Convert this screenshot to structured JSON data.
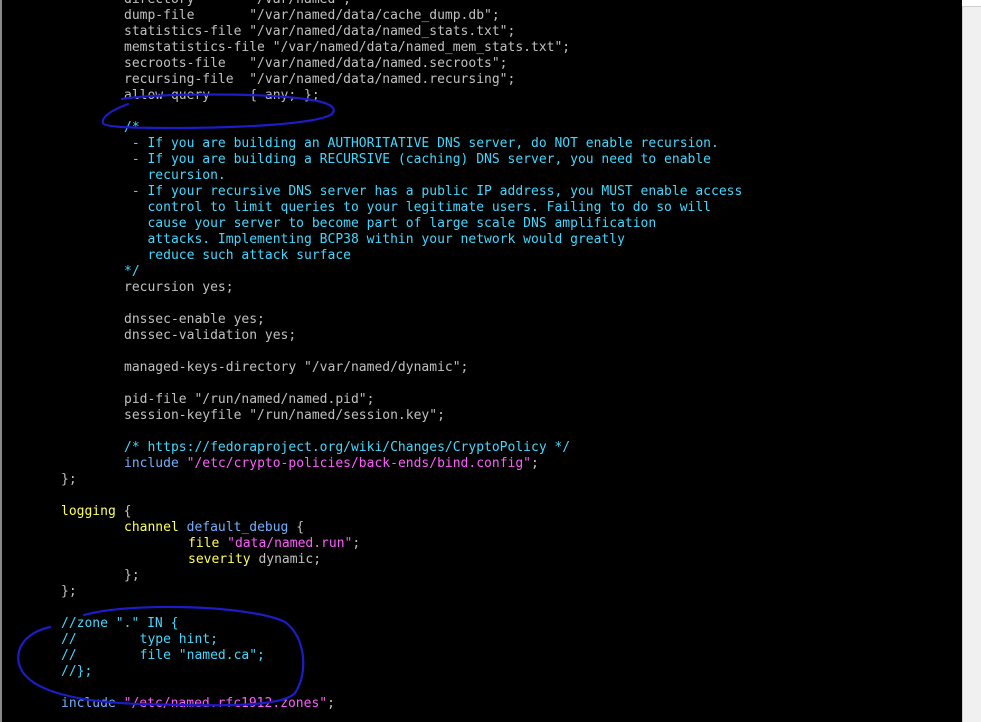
{
  "colors": {
    "background": "#000000",
    "default": "#c0c0c0",
    "comment": "#40d8ff",
    "keyword": "#ffff55",
    "type": "#70b0ff",
    "string": "#ff5cff",
    "annotation": "#1c1cc8"
  },
  "lines": [
    {
      "indent": 2,
      "tokens": [
        {
          "t": "directory       \"/var/named\";",
          "c": "default"
        }
      ]
    },
    {
      "indent": 2,
      "tokens": [
        {
          "t": "dump-file       \"/var/named/data/cache_dump.db\";",
          "c": "default"
        }
      ]
    },
    {
      "indent": 2,
      "tokens": [
        {
          "t": "statistics-file \"/var/named/data/named_stats.txt\";",
          "c": "default"
        }
      ]
    },
    {
      "indent": 2,
      "tokens": [
        {
          "t": "memstatistics-file \"/var/named/data/named_mem_stats.txt\";",
          "c": "default"
        }
      ]
    },
    {
      "indent": 2,
      "tokens": [
        {
          "t": "secroots-file   \"/var/named/data/named.secroots\";",
          "c": "default"
        }
      ]
    },
    {
      "indent": 2,
      "tokens": [
        {
          "t": "recursing-file  \"/var/named/data/named.recursing\";",
          "c": "default"
        }
      ]
    },
    {
      "indent": 2,
      "tokens": [
        {
          "t": "allow-query     { any; };",
          "c": "default"
        }
      ]
    },
    {
      "indent": 0,
      "tokens": []
    },
    {
      "indent": 2,
      "tokens": [
        {
          "t": "/*",
          "c": "comment"
        }
      ]
    },
    {
      "indent": 2,
      "tokens": [
        {
          "t": " - If you are building an AUTHORITATIVE DNS server, do NOT enable recursion.",
          "c": "comment"
        }
      ]
    },
    {
      "indent": 2,
      "tokens": [
        {
          "t": " - If you are building a RECURSIVE (caching) DNS server, you need to enable",
          "c": "comment"
        }
      ]
    },
    {
      "indent": 2,
      "tokens": [
        {
          "t": "   recursion.",
          "c": "comment"
        }
      ]
    },
    {
      "indent": 2,
      "tokens": [
        {
          "t": " - If your recursive DNS server has a public IP address, you MUST enable access",
          "c": "comment"
        }
      ]
    },
    {
      "indent": 2,
      "tokens": [
        {
          "t": "   control to limit queries to your legitimate users. Failing to do so will",
          "c": "comment"
        }
      ]
    },
    {
      "indent": 2,
      "tokens": [
        {
          "t": "   cause your server to become part of large scale DNS amplification",
          "c": "comment"
        }
      ]
    },
    {
      "indent": 2,
      "tokens": [
        {
          "t": "   attacks. Implementing BCP38 within your network would greatly",
          "c": "comment"
        }
      ]
    },
    {
      "indent": 2,
      "tokens": [
        {
          "t": "   reduce such attack surface",
          "c": "comment"
        }
      ]
    },
    {
      "indent": 2,
      "tokens": [
        {
          "t": "*/",
          "c": "comment"
        }
      ]
    },
    {
      "indent": 2,
      "tokens": [
        {
          "t": "recursion yes;",
          "c": "default"
        }
      ]
    },
    {
      "indent": 0,
      "tokens": []
    },
    {
      "indent": 2,
      "tokens": [
        {
          "t": "dnssec-enable yes;",
          "c": "default"
        }
      ]
    },
    {
      "indent": 2,
      "tokens": [
        {
          "t": "dnssec-validation yes;",
          "c": "default"
        }
      ]
    },
    {
      "indent": 0,
      "tokens": []
    },
    {
      "indent": 2,
      "tokens": [
        {
          "t": "managed-keys-directory \"/var/named/dynamic\";",
          "c": "default"
        }
      ]
    },
    {
      "indent": 0,
      "tokens": []
    },
    {
      "indent": 2,
      "tokens": [
        {
          "t": "pid-file \"/run/named/named.pid\";",
          "c": "default"
        }
      ]
    },
    {
      "indent": 2,
      "tokens": [
        {
          "t": "session-keyfile \"/run/named/session.key\";",
          "c": "default"
        }
      ]
    },
    {
      "indent": 0,
      "tokens": []
    },
    {
      "indent": 2,
      "tokens": [
        {
          "t": "/* https://fedoraproject.org/wiki/Changes/CryptoPolicy */",
          "c": "comment"
        }
      ]
    },
    {
      "indent": 2,
      "tokens": [
        {
          "t": "include",
          "c": "type"
        },
        {
          "t": " ",
          "c": "default"
        },
        {
          "t": "\"/etc/crypto-policies/back-ends/bind.config\"",
          "c": "string"
        },
        {
          "t": ";",
          "c": "default"
        }
      ]
    },
    {
      "indent": 1,
      "tokens": [
        {
          "t": "};",
          "c": "default"
        }
      ]
    },
    {
      "indent": 0,
      "tokens": []
    },
    {
      "indent": 1,
      "tokens": [
        {
          "t": "logging",
          "c": "keyword"
        },
        {
          "t": " {",
          "c": "default"
        }
      ]
    },
    {
      "indent": 2,
      "tokens": [
        {
          "t": "channel",
          "c": "keyword"
        },
        {
          "t": " ",
          "c": "default"
        },
        {
          "t": "default_debug",
          "c": "type"
        },
        {
          "t": " {",
          "c": "default"
        }
      ]
    },
    {
      "indent": 3,
      "tokens": [
        {
          "t": "file",
          "c": "keyword"
        },
        {
          "t": " ",
          "c": "default"
        },
        {
          "t": "\"data/named.run\"",
          "c": "string"
        },
        {
          "t": ";",
          "c": "default"
        }
      ]
    },
    {
      "indent": 3,
      "tokens": [
        {
          "t": "severity",
          "c": "keyword"
        },
        {
          "t": " dynamic;",
          "c": "default"
        }
      ]
    },
    {
      "indent": 2,
      "tokens": [
        {
          "t": "};",
          "c": "default"
        }
      ]
    },
    {
      "indent": 1,
      "tokens": [
        {
          "t": "};",
          "c": "default"
        }
      ]
    },
    {
      "indent": 0,
      "tokens": []
    },
    {
      "indent": 1,
      "tokens": [
        {
          "t": "//zone \".\" IN {",
          "c": "comment"
        }
      ]
    },
    {
      "indent": 1,
      "tokens": [
        {
          "t": "//",
          "c": "comment"
        },
        {
          "gap": 1
        },
        {
          "t": "type hint;",
          "c": "comment"
        }
      ]
    },
    {
      "indent": 1,
      "tokens": [
        {
          "t": "//",
          "c": "comment"
        },
        {
          "gap": 1
        },
        {
          "t": "file \"named.ca\";",
          "c": "comment"
        }
      ]
    },
    {
      "indent": 1,
      "tokens": [
        {
          "t": "//};",
          "c": "comment"
        }
      ]
    },
    {
      "indent": 0,
      "tokens": []
    },
    {
      "indent": 1,
      "tokens": [
        {
          "t": "include",
          "c": "type"
        },
        {
          "t": " ",
          "c": "default"
        },
        {
          "t": "\"/etc/named.rfc1912.zones\"",
          "c": "string"
        },
        {
          "t": ";",
          "c": "default"
        }
      ]
    }
  ]
}
